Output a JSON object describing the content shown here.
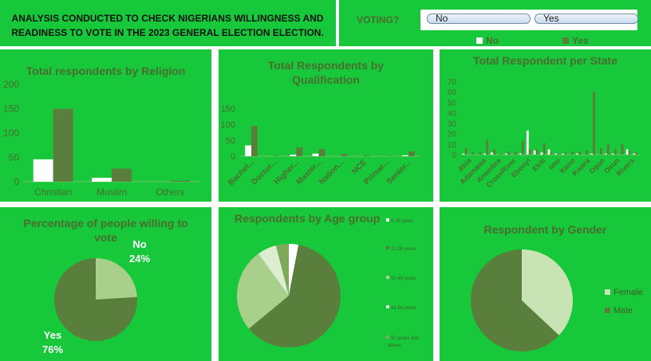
{
  "title": "ANALYSIS CONDUCTED TO CHECK NIGERIANS WILLINGNESS AND READINESS TO VOTE IN THE 2023 GENERAL ELECTION ELECTION.",
  "voting_slicer": {
    "label": "VOTING?",
    "options": [
      "No",
      "Yes"
    ],
    "legend": [
      "No",
      "Yes"
    ]
  },
  "colors": {
    "panel": "#16c83a",
    "no": "#ffffff",
    "yes": "#5a7f3c",
    "title": "#4a6d2f"
  },
  "chart_data": [
    {
      "id": "religion",
      "type": "bar",
      "title": "Total respondents by Religion",
      "categories": [
        "Christian",
        "Muslim",
        "Others"
      ],
      "series": [
        {
          "name": "No",
          "values": [
            46,
            8,
            0
          ]
        },
        {
          "name": "Yes",
          "values": [
            150,
            27,
            2
          ]
        }
      ],
      "yticks": [
        "0",
        "50",
        "100",
        "150",
        "200"
      ],
      "ylim": [
        0,
        200
      ],
      "grid": false
    },
    {
      "id": "qualification",
      "type": "bar",
      "title": "Total Respondents by Qualification",
      "categories": [
        "Bachel...",
        "Doctor...",
        "Higher...",
        "Master...",
        "Nation...",
        "NCE",
        "Primar...",
        "Senior..."
      ],
      "series": [
        {
          "name": "No",
          "values": [
            34,
            0,
            5,
            8,
            0,
            0,
            0,
            3
          ]
        },
        {
          "name": "Yes",
          "values": [
            95,
            1,
            27,
            22,
            7,
            2,
            1,
            15
          ]
        }
      ],
      "yticks": [
        "0",
        "50",
        "100",
        "150"
      ],
      "ylim": [
        0,
        150
      ],
      "grid": false
    },
    {
      "id": "state",
      "type": "bar",
      "title": "Total Respondent per State",
      "categories": [
        "Abia",
        "Adamawa",
        "Anambra",
        "CrossRiver",
        "Ebonyi",
        "Ekiti",
        "Imo",
        "Kano",
        "Kwara",
        "Ogun",
        "Osun",
        "Rivers"
      ],
      "series": [
        {
          "name": "No",
          "values": [
            1,
            0,
            0,
            1,
            2,
            0,
            1,
            0,
            1,
            23,
            4,
            2,
            5,
            1,
            1,
            0,
            1,
            0,
            1,
            0,
            1,
            1,
            0,
            5,
            1
          ]
        },
        {
          "name": "Yes",
          "values": [
            6,
            2,
            2,
            14,
            5,
            1,
            3,
            3,
            13,
            5,
            5,
            11,
            2,
            1,
            2,
            3,
            3,
            4,
            60,
            6,
            10,
            5,
            10,
            4,
            2
          ]
        }
      ],
      "yticks": [
        "0",
        "10",
        "20",
        "30",
        "40",
        "50",
        "60",
        "70"
      ],
      "ylim": [
        0,
        70
      ],
      "grid": false
    },
    {
      "id": "willing",
      "type": "pie",
      "title": "Percentage of people willing to vote",
      "slices": [
        {
          "label": "No",
          "value": 24,
          "display": "24%",
          "color": "#a8d08a"
        },
        {
          "label": "Yes",
          "value": 76,
          "display": "76%",
          "color": "#5a7f3c"
        }
      ]
    },
    {
      "id": "age",
      "type": "pie",
      "title": "Respondents by Age group",
      "slices": [
        {
          "label": "0-20 years",
          "value": 3,
          "color": "#ffffff"
        },
        {
          "label": "21-30 years",
          "value": 61,
          "color": "#5a7f3c"
        },
        {
          "label": "31-40 years",
          "value": 26,
          "color": "#a8d08a"
        },
        {
          "label": "41-50 years",
          "value": 6,
          "color": "#dcedd0"
        },
        {
          "label": "50 years and above",
          "value": 4,
          "color": "#7ea95a"
        }
      ],
      "legend": [
        "0-20 years",
        "21-30 years",
        "31-40 years",
        "41-50 years",
        "50 years and above"
      ]
    },
    {
      "id": "gender",
      "type": "pie",
      "title": "Respondent by Gender",
      "slices": [
        {
          "label": "Female",
          "value": 37,
          "color": "#c8e3b4"
        },
        {
          "label": "Male",
          "value": 63,
          "color": "#5a7f3c"
        }
      ],
      "legend": [
        "Female",
        "Male"
      ]
    }
  ]
}
